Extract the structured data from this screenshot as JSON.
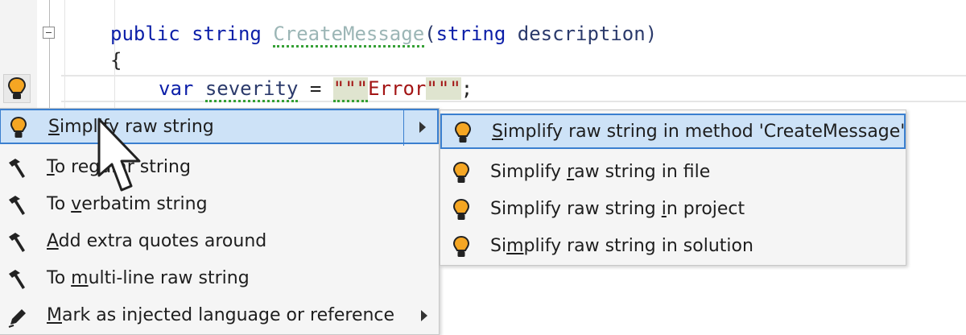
{
  "editor": {
    "line1": {
      "kw1": "public",
      "kw2": "string",
      "method": "CreateMessage",
      "paren_open": "(",
      "param_type": "string",
      "param_name": "description",
      "paren_close": ")"
    },
    "line2": {
      "brace": "{"
    },
    "line3": {
      "kw": "var",
      "var_name": "severity",
      "eq": " = ",
      "q_open": "\"\"\"",
      "str_text": "Error",
      "q_close": "\"\"\"",
      "semi": ";"
    }
  },
  "main_menu": {
    "items": [
      {
        "label_u": "S",
        "label_rest": "implify raw string",
        "icon": "lightbulb-icon",
        "has_submenu": true
      },
      {
        "label_u": "T",
        "label_rest": "o regular string",
        "icon": "hammer-icon"
      },
      {
        "label_pre": "To ",
        "label_u": "v",
        "label_rest": "erbatim string",
        "icon": "hammer-icon"
      },
      {
        "label_u": "A",
        "label_rest": "dd extra quotes around",
        "icon": "hammer-icon"
      },
      {
        "label_pre": "To ",
        "label_u": "m",
        "label_rest": "ulti-line raw string",
        "icon": "hammer-icon"
      },
      {
        "label_u": "M",
        "label_rest": "ark as injected language or reference",
        "icon": "pen-icon",
        "has_submenu": true
      }
    ]
  },
  "sub_menu": {
    "items": [
      {
        "label_u": "S",
        "label_rest": "implify raw string in method 'CreateMessage'",
        "icon": "lightbulb-icon"
      },
      {
        "label_pre": "Simplify ",
        "label_u": "r",
        "label_rest": "aw string in file",
        "icon": "lightbulb-icon"
      },
      {
        "label_pre": "Simplify raw string ",
        "label_u": "i",
        "label_rest": "n project",
        "icon": "lightbulb-icon"
      },
      {
        "label_pre": "Si",
        "label_u": "m",
        "label_rest": "plify raw string in solution",
        "icon": "lightbulb-icon"
      }
    ]
  },
  "colors": {
    "selection_bg": "#cde2f7",
    "selection_border": "#3a7fcf",
    "keyword": "#0b1ea8",
    "string": "#a31515",
    "bulb": "#f5a623"
  }
}
